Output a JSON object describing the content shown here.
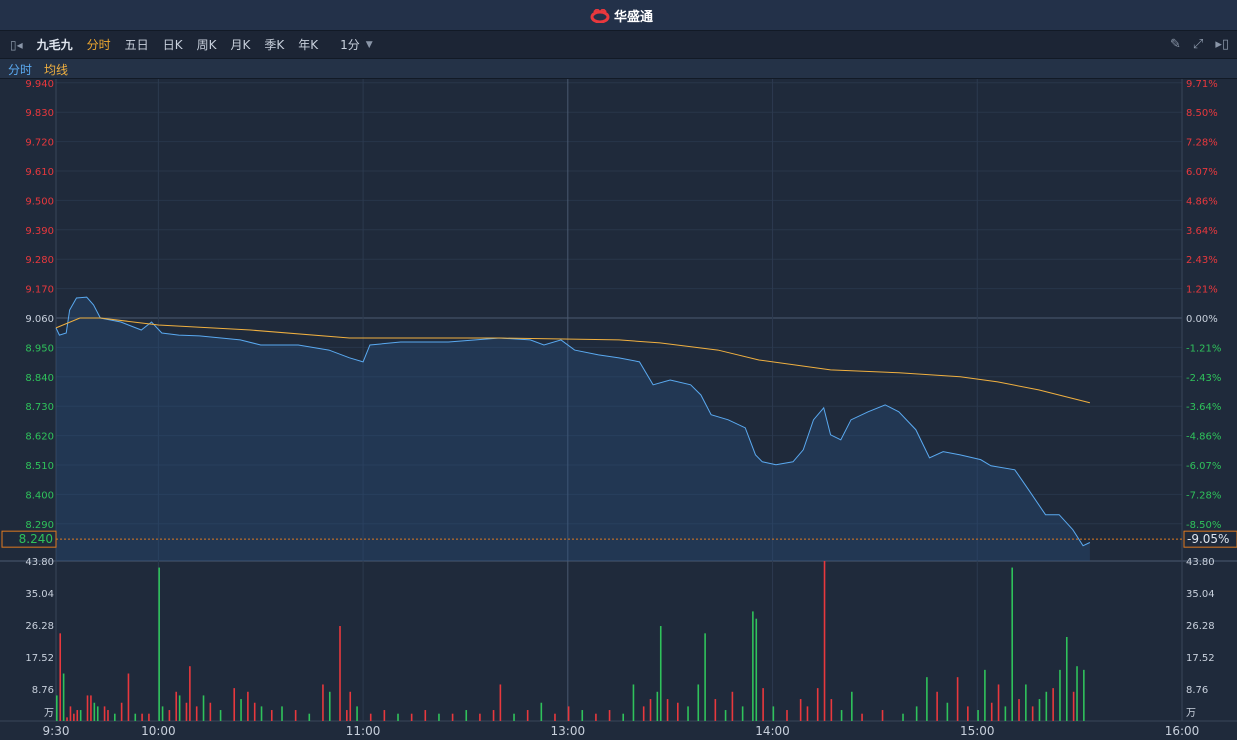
{
  "app": {
    "logo_text": "华盛通"
  },
  "toolbar": {
    "stock_name": "九毛九",
    "tabs": [
      "分时",
      "五日",
      "日K",
      "周K",
      "月K",
      "季K",
      "年K"
    ],
    "active_tab": "分时",
    "interval": "1分"
  },
  "legend": {
    "line1": "分时",
    "line2": "均线"
  },
  "colors": {
    "up": "#e8383d",
    "down": "#2fc25b",
    "price_line": "#5aa9f0",
    "avg_line": "#f0b040",
    "accent": "#e07a20"
  },
  "current": {
    "price": "8.240",
    "change_pct": "-9.05%"
  },
  "chart_data": {
    "type": "line",
    "prev_close": 9.06,
    "price_labels": [
      "9.940",
      "9.830",
      "9.720",
      "9.610",
      "9.500",
      "9.390",
      "9.280",
      "9.170",
      "9.060",
      "8.950",
      "8.840",
      "8.730",
      "8.620",
      "8.510",
      "8.400",
      "8.290"
    ],
    "pct_labels": [
      "9.71%",
      "8.50%",
      "7.28%",
      "6.07%",
      "4.86%",
      "3.64%",
      "2.43%",
      "1.21%",
      "0.00%",
      "-1.21%",
      "-2.43%",
      "-3.64%",
      "-4.86%",
      "-6.07%",
      "-7.28%",
      "-8.50%"
    ],
    "volume_labels": [
      "43.80",
      "35.04",
      "26.28",
      "17.52",
      "8.76",
      "万"
    ],
    "volume_max": 43.8,
    "time_labels": [
      "9:30",
      "10:00",
      "11:00",
      "13:00",
      "14:00",
      "15:00",
      "16:00"
    ],
    "time_label_minutes": [
      0,
      30,
      90,
      150,
      210,
      270,
      330
    ],
    "price_series": [
      [
        0,
        9.023
      ],
      [
        1,
        8.996
      ],
      [
        3,
        9.004
      ],
      [
        4,
        9.09
      ],
      [
        6,
        9.135
      ],
      [
        9,
        9.138
      ],
      [
        11,
        9.109
      ],
      [
        13,
        9.06
      ],
      [
        19,
        9.045
      ],
      [
        25,
        9.015
      ],
      [
        28,
        9.045
      ],
      [
        31,
        9.004
      ],
      [
        36,
        8.996
      ],
      [
        42,
        8.993
      ],
      [
        54,
        8.978
      ],
      [
        60,
        8.959
      ],
      [
        71,
        8.959
      ],
      [
        80,
        8.94
      ],
      [
        86,
        8.911
      ],
      [
        90,
        8.896
      ],
      [
        92,
        8.959
      ],
      [
        101,
        8.97
      ],
      [
        115,
        8.97
      ],
      [
        130,
        8.985
      ],
      [
        139,
        8.978
      ],
      [
        143,
        8.959
      ],
      [
        148,
        8.978
      ],
      [
        152,
        8.94
      ],
      [
        159,
        8.922
      ],
      [
        165,
        8.911
      ],
      [
        171,
        8.896
      ],
      [
        175,
        8.81
      ],
      [
        180,
        8.828
      ],
      [
        186,
        8.81
      ],
      [
        189,
        8.772
      ],
      [
        192,
        8.698
      ],
      [
        197,
        8.679
      ],
      [
        202,
        8.649
      ],
      [
        205,
        8.548
      ],
      [
        207,
        8.522
      ],
      [
        211,
        8.511
      ],
      [
        216,
        8.522
      ],
      [
        219,
        8.567
      ],
      [
        222,
        8.679
      ],
      [
        225,
        8.724
      ],
      [
        227,
        8.623
      ],
      [
        230,
        8.604
      ],
      [
        233,
        8.679
      ],
      [
        238,
        8.709
      ],
      [
        243,
        8.735
      ],
      [
        247,
        8.709
      ],
      [
        252,
        8.642
      ],
      [
        256,
        8.537
      ],
      [
        260,
        8.56
      ],
      [
        265,
        8.548
      ],
      [
        271,
        8.53
      ],
      [
        274,
        8.507
      ],
      [
        281,
        8.492
      ],
      [
        285,
        8.418
      ],
      [
        290,
        8.324
      ],
      [
        294,
        8.324
      ],
      [
        298,
        8.268
      ],
      [
        301,
        8.208
      ],
      [
        303,
        8.22
      ]
    ],
    "avg_series": [
      [
        0,
        9.023
      ],
      [
        7,
        9.06
      ],
      [
        13,
        9.06
      ],
      [
        30,
        9.034
      ],
      [
        57,
        9.015
      ],
      [
        86,
        8.985
      ],
      [
        130,
        8.985
      ],
      [
        165,
        8.978
      ],
      [
        177,
        8.967
      ],
      [
        194,
        8.94
      ],
      [
        206,
        8.903
      ],
      [
        227,
        8.866
      ],
      [
        247,
        8.855
      ],
      [
        265,
        8.84
      ],
      [
        276,
        8.821
      ],
      [
        288,
        8.791
      ],
      [
        297,
        8.762
      ],
      [
        303,
        8.743
      ]
    ],
    "volume": [
      [
        0,
        7,
        0
      ],
      [
        1,
        24,
        1
      ],
      [
        2,
        13,
        0
      ],
      [
        3,
        1,
        1
      ],
      [
        4,
        4,
        1
      ],
      [
        5,
        2,
        1
      ],
      [
        6,
        3,
        1
      ],
      [
        7,
        3,
        0
      ],
      [
        9,
        7,
        1
      ],
      [
        10,
        7,
        1
      ],
      [
        11,
        5,
        0
      ],
      [
        12,
        4,
        0
      ],
      [
        14,
        4,
        1
      ],
      [
        15,
        3,
        1
      ],
      [
        17,
        2,
        0
      ],
      [
        19,
        5,
        1
      ],
      [
        21,
        13,
        1
      ],
      [
        23,
        2,
        0
      ],
      [
        25,
        2,
        1
      ],
      [
        27,
        2,
        1
      ],
      [
        30,
        42,
        0
      ],
      [
        31,
        4,
        0
      ],
      [
        33,
        3,
        1
      ],
      [
        35,
        8,
        1
      ],
      [
        36,
        7,
        0
      ],
      [
        38,
        5,
        1
      ],
      [
        39,
        15,
        1
      ],
      [
        41,
        4,
        1
      ],
      [
        43,
        7,
        0
      ],
      [
        45,
        5,
        1
      ],
      [
        48,
        3,
        0
      ],
      [
        52,
        9,
        1
      ],
      [
        54,
        6,
        0
      ],
      [
        56,
        8,
        1
      ],
      [
        58,
        5,
        1
      ],
      [
        60,
        4,
        0
      ],
      [
        63,
        3,
        1
      ],
      [
        66,
        4,
        0
      ],
      [
        70,
        3,
        1
      ],
      [
        74,
        2,
        0
      ],
      [
        78,
        10,
        1
      ],
      [
        80,
        8,
        0
      ],
      [
        83,
        26,
        1
      ],
      [
        85,
        3,
        1
      ],
      [
        86,
        8,
        1
      ],
      [
        88,
        4,
        0
      ],
      [
        92,
        2,
        1
      ],
      [
        96,
        3,
        1
      ],
      [
        100,
        2,
        0
      ],
      [
        104,
        2,
        1
      ],
      [
        108,
        3,
        1
      ],
      [
        112,
        2,
        0
      ],
      [
        116,
        2,
        1
      ],
      [
        120,
        3,
        0
      ],
      [
        124,
        2,
        1
      ],
      [
        128,
        3,
        1
      ],
      [
        130,
        10,
        1
      ],
      [
        134,
        2,
        0
      ],
      [
        138,
        3,
        1
      ],
      [
        142,
        5,
        0
      ],
      [
        146,
        2,
        1
      ],
      [
        150,
        4,
        1
      ],
      [
        154,
        3,
        0
      ],
      [
        158,
        2,
        1
      ],
      [
        162,
        3,
        1
      ],
      [
        166,
        2,
        0
      ],
      [
        169,
        10,
        0
      ],
      [
        172,
        4,
        1
      ],
      [
        174,
        6,
        1
      ],
      [
        176,
        8,
        0
      ],
      [
        177,
        26,
        0
      ],
      [
        179,
        6,
        1
      ],
      [
        182,
        5,
        1
      ],
      [
        185,
        4,
        0
      ],
      [
        188,
        10,
        0
      ],
      [
        190,
        24,
        0
      ],
      [
        193,
        6,
        1
      ],
      [
        196,
        3,
        0
      ],
      [
        198,
        8,
        1
      ],
      [
        201,
        4,
        0
      ],
      [
        204,
        30,
        0
      ],
      [
        205,
        28,
        0
      ],
      [
        207,
        9,
        1
      ],
      [
        210,
        4,
        0
      ],
      [
        214,
        3,
        1
      ],
      [
        218,
        6,
        1
      ],
      [
        220,
        4,
        1
      ],
      [
        223,
        9,
        1
      ],
      [
        225,
        43.8,
        1
      ],
      [
        227,
        6,
        1
      ],
      [
        230,
        3,
        0
      ],
      [
        233,
        8,
        0
      ],
      [
        236,
        2,
        1
      ],
      [
        242,
        3,
        1
      ],
      [
        248,
        2,
        0
      ],
      [
        252,
        4,
        0
      ],
      [
        255,
        12,
        0
      ],
      [
        258,
        8,
        1
      ],
      [
        261,
        5,
        0
      ],
      [
        264,
        12,
        1
      ],
      [
        267,
        4,
        1
      ],
      [
        270,
        3,
        0
      ],
      [
        272,
        14,
        0
      ],
      [
        274,
        5,
        1
      ],
      [
        276,
        10,
        1
      ],
      [
        278,
        4,
        0
      ],
      [
        280,
        42,
        0
      ],
      [
        282,
        6,
        1
      ],
      [
        284,
        10,
        0
      ],
      [
        286,
        4,
        1
      ],
      [
        288,
        6,
        0
      ],
      [
        290,
        8,
        0
      ],
      [
        292,
        9,
        1
      ],
      [
        294,
        14,
        0
      ],
      [
        296,
        23,
        0
      ],
      [
        298,
        8,
        1
      ],
      [
        299,
        15,
        0
      ],
      [
        301,
        14,
        0
      ]
    ]
  }
}
